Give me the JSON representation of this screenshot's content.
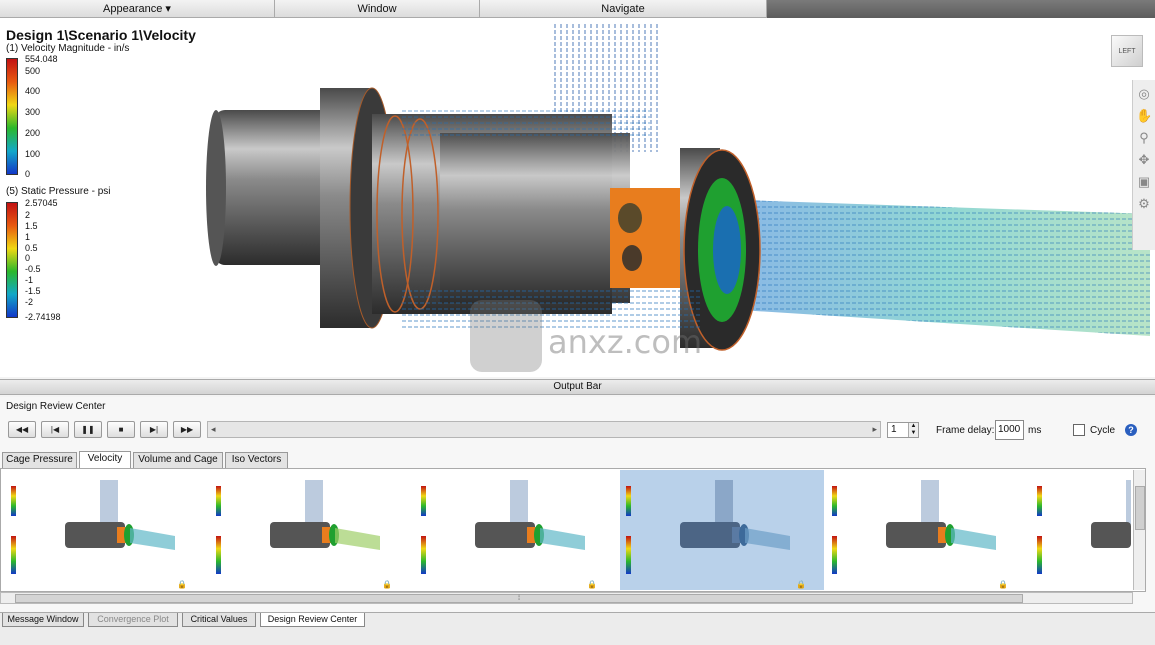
{
  "menu": {
    "tabs": [
      {
        "label": "Appearance ▾"
      },
      {
        "label": "Window"
      },
      {
        "label": "Navigate"
      }
    ]
  },
  "viewport": {
    "title": "Design 1\\Scenario 1\\Velocity",
    "legend_velocity": {
      "title": "(1) Velocity Magnitude - in/s",
      "ticks": [
        "554.048",
        "500",
        "400",
        "300",
        "200",
        "100",
        "0"
      ]
    },
    "legend_pressure": {
      "title": "(5) Static Pressure - psi",
      "ticks": [
        "2.57045",
        "2",
        "1.5",
        "1",
        "0.5",
        "0",
        "-0.5",
        "-1",
        "-1.5",
        "-2",
        "-2.74198"
      ]
    },
    "viewcube_label": "LEFT",
    "watermark": "anxz.com"
  },
  "output_bar": {
    "label": "Output Bar"
  },
  "drc": {
    "label": "Design Review Center",
    "frame_value": "1",
    "frame_delay_label": "Frame delay:",
    "frame_delay_value": "1000",
    "ms_label": "ms",
    "cycle_label": "Cycle",
    "help_label": "?",
    "subtabs": [
      {
        "label": "Cage Pressure"
      },
      {
        "label": "Velocity"
      },
      {
        "label": "Volume and Cage"
      },
      {
        "label": "Iso Vectors"
      }
    ]
  },
  "bottom_tabs": [
    {
      "label": "Message Window"
    },
    {
      "label": "Convergence Plot"
    },
    {
      "label": "Critical Values"
    },
    {
      "label": "Design Review Center"
    }
  ],
  "colors": {
    "selected_thumbnail": "#b9d1ea",
    "accent_blue": "#2a5fbf"
  }
}
